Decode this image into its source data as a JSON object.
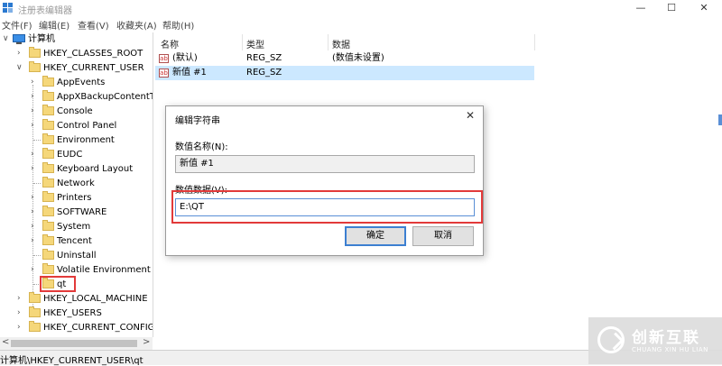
{
  "window": {
    "title": "注册表编辑器",
    "minimize": "—",
    "maximize": "☐",
    "close": "✕"
  },
  "menu": [
    "文件(F)",
    "编辑(E)",
    "查看(V)",
    "收藏夹(A)",
    "帮助(H)"
  ],
  "tree": {
    "root": "计算机",
    "top_keys": [
      "HKEY_CLASSES_ROOT",
      "HKEY_CURRENT_USER"
    ],
    "hkcu_children": [
      "AppEvents",
      "AppXBackupContentTy",
      "Console",
      "Control Panel",
      "Environment",
      "EUDC",
      "Keyboard Layout",
      "Network",
      "Printers",
      "SOFTWARE",
      "System",
      "Tencent",
      "Uninstall",
      "Volatile Environment",
      "qt"
    ],
    "bottom_keys": [
      "HKEY_LOCAL_MACHINE",
      "HKEY_USERS",
      "HKEY_CURRENT_CONFIG"
    ]
  },
  "list": {
    "headers": [
      "名称",
      "类型",
      "数据"
    ],
    "rows": [
      {
        "icon": "ab",
        "name": "(默认)",
        "type": "REG_SZ",
        "data": "(数值未设置)"
      },
      {
        "icon": "ab",
        "name": "新值 #1",
        "type": "REG_SZ",
        "data": ""
      }
    ]
  },
  "dialog": {
    "title": "编辑字符串",
    "close": "✕",
    "name_label": "数值名称(N):",
    "name_value": "新值 #1",
    "data_label": "数值数据(V):",
    "data_value": "E:\\QT",
    "ok": "确定",
    "cancel": "取消"
  },
  "statusbar": {
    "path": "计算机\\HKEY_CURRENT_USER\\qt"
  },
  "scroll": {
    "left_arrow": "<",
    "right_arrow": ">"
  },
  "watermark": {
    "text": "创新互联",
    "subtext": "CHUANG XIN HU LIAN"
  },
  "colors": {
    "highlight": "#e23a3a",
    "selected_row": "#cce8ff",
    "folder": "#f5d77a",
    "accent": "#3c7fd1"
  }
}
